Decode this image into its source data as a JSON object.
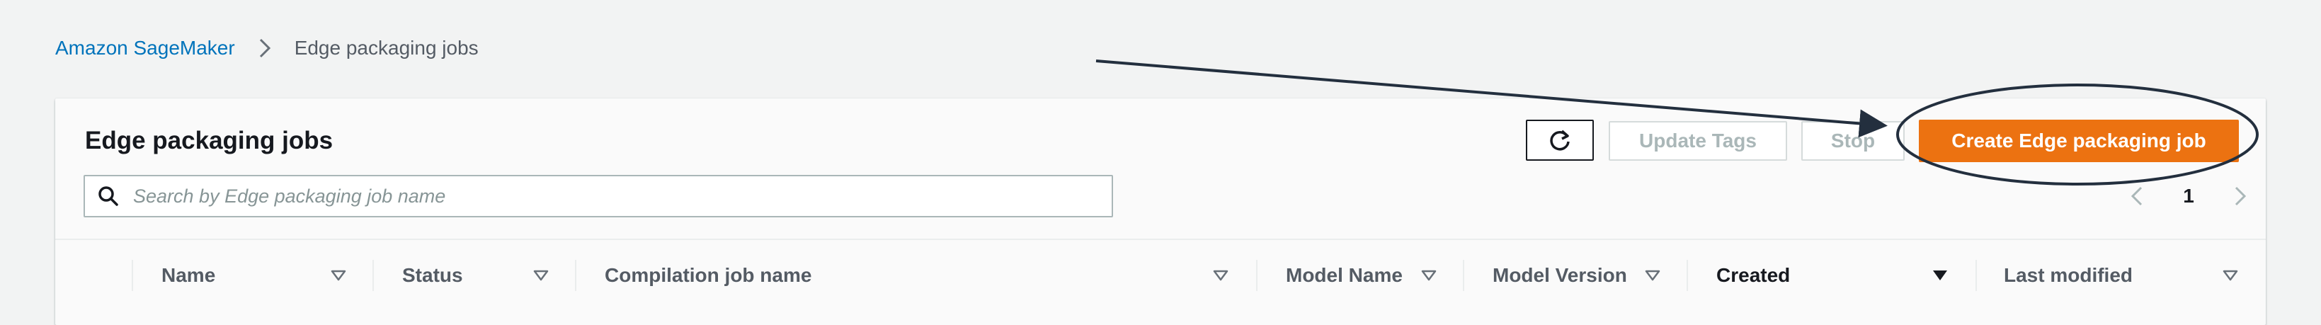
{
  "breadcrumb": {
    "root": "Amazon SageMaker",
    "current": "Edge packaging jobs"
  },
  "panel": {
    "title": "Edge packaging jobs",
    "refresh_icon": "refresh-icon",
    "update_tags_label": "Update Tags",
    "stop_label": "Stop",
    "create_label": "Create Edge packaging job"
  },
  "search": {
    "placeholder": "Search by Edge packaging job name",
    "value": ""
  },
  "pagination": {
    "current_page": "1"
  },
  "table": {
    "columns": [
      {
        "label": "Name",
        "sortable": true,
        "active": false
      },
      {
        "label": "Status",
        "sortable": true,
        "active": false
      },
      {
        "label": "Compilation job name",
        "sortable": true,
        "active": false
      },
      {
        "label": "Model Name",
        "sortable": true,
        "active": false
      },
      {
        "label": "Model Version",
        "sortable": true,
        "active": false
      },
      {
        "label": "Created",
        "sortable": true,
        "active": true,
        "sort": "descending"
      },
      {
        "label": "Last modified",
        "sortable": true,
        "active": false
      }
    ]
  },
  "colors": {
    "primary": "#ec7211",
    "link": "#0073bb",
    "annotation": "#232f3e"
  }
}
